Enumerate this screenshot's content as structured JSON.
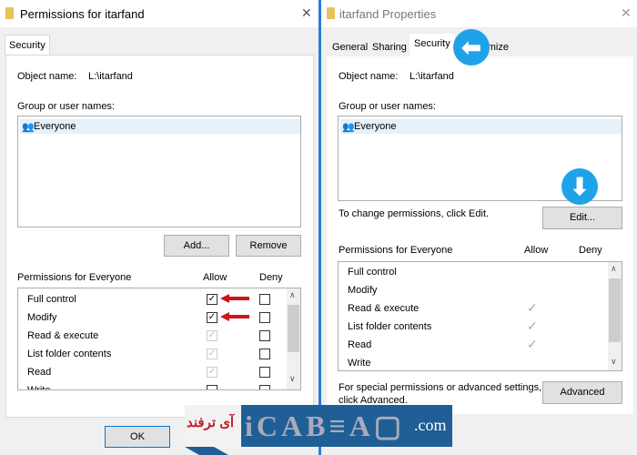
{
  "left": {
    "title": "Permissions for itarfand",
    "tab": "Security",
    "object_name_label": "Object name:",
    "object_name_value": "L:\\itarfand",
    "group_label": "Group or user names:",
    "users": [
      "Everyone"
    ],
    "add_label": "Add...",
    "remove_label": "Remove",
    "perms_label": "Permissions for Everyone",
    "allow_label": "Allow",
    "deny_label": "Deny",
    "permissions": [
      {
        "name": "Full control",
        "allow": true,
        "allow_disabled": false,
        "deny": false
      },
      {
        "name": "Modify",
        "allow": true,
        "allow_disabled": false,
        "deny": false
      },
      {
        "name": "Read & execute",
        "allow": true,
        "allow_disabled": true,
        "deny": false
      },
      {
        "name": "List folder contents",
        "allow": true,
        "allow_disabled": true,
        "deny": false
      },
      {
        "name": "Read",
        "allow": true,
        "allow_disabled": true,
        "deny": false
      },
      {
        "name": "Write",
        "allow": false,
        "allow_disabled": false,
        "deny": false
      }
    ],
    "ok_label": "OK"
  },
  "right": {
    "title": "itarfand Properties",
    "tabs": [
      "General",
      "Sharing",
      "Security",
      "Customize"
    ],
    "active_tab": "Security",
    "object_name_label": "Object name:",
    "object_name_value": "L:\\itarfand",
    "group_label": "Group or user names:",
    "users": [
      "Everyone"
    ],
    "change_text": "To change permissions, click Edit.",
    "edit_label": "Edit...",
    "perms_label": "Permissions for Everyone",
    "allow_label": "Allow",
    "deny_label": "Deny",
    "permissions": [
      {
        "name": "Full control",
        "allow": false
      },
      {
        "name": "Modify",
        "allow": false
      },
      {
        "name": "Read & execute",
        "allow": true
      },
      {
        "name": "List folder contents",
        "allow": true
      },
      {
        "name": "Read",
        "allow": true
      },
      {
        "name": "Write",
        "allow": false
      }
    ],
    "advanced_text_1": "For special permissions or advanced settings,",
    "advanced_text_2": "click Advanced.",
    "advanced_label": "Advanced"
  },
  "watermark": {
    "text_fa": "آی ترفند",
    "domain": ".com"
  },
  "colors": {
    "accent": "#1ea3e8",
    "arrow": "#d0141a",
    "divider": "#2b7cd3"
  }
}
